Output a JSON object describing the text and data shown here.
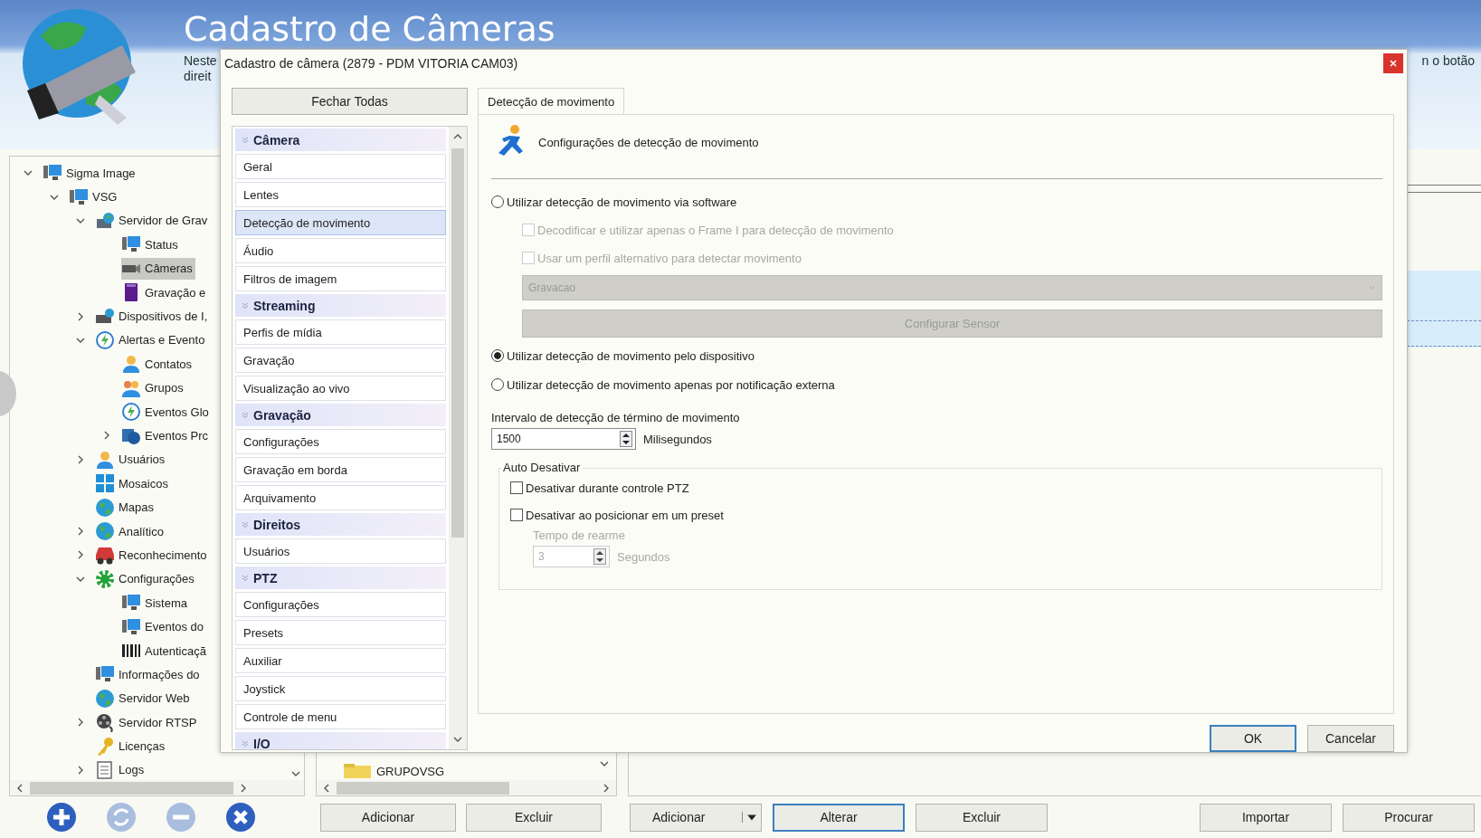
{
  "header": {
    "title": "Cadastro de Câmeras",
    "description_lines": [
      "Neste",
      "direit"
    ],
    "right_text": "n o botão"
  },
  "tree": {
    "items": [
      {
        "label": "Sigma Image",
        "expanded": true,
        "children": [
          {
            "label": "VSG",
            "expanded": true,
            "children": [
              {
                "label": "Servidor de Grav",
                "expanded": true,
                "children": [
                  {
                    "label": "Status",
                    "selected": false
                  },
                  {
                    "label": "Câmeras",
                    "selected": true
                  },
                  {
                    "label": "Gravação e",
                    "selected": false
                  }
                ],
                "selected": false
              },
              {
                "label": "Dispositivos de I,",
                "expanded": false,
                "selected": false
              },
              {
                "label": "Alertas e Evento",
                "expanded": true,
                "selected": false,
                "children": [
                  {
                    "label": "Contatos",
                    "selected": false
                  },
                  {
                    "label": "Grupos",
                    "selected": false
                  },
                  {
                    "label": "Eventos Glo",
                    "selected": false
                  },
                  {
                    "label": "Eventos Prc",
                    "expanded": false,
                    "selected": false
                  }
                ]
              },
              {
                "label": "Usuários",
                "expanded": false,
                "selected": false
              },
              {
                "label": "Mosaicos",
                "selected": false
              },
              {
                "label": "Mapas",
                "selected": false
              },
              {
                "label": "Analítico",
                "expanded": false,
                "selected": false
              },
              {
                "label": "Reconhecimento",
                "expanded": false,
                "selected": false
              },
              {
                "label": "Configurações",
                "expanded": true,
                "selected": false,
                "children": [
                  {
                    "label": "Sistema",
                    "selected": false
                  },
                  {
                    "label": "Eventos do",
                    "selected": false
                  },
                  {
                    "label": "Autenticaçã",
                    "selected": false
                  }
                ]
              },
              {
                "label": "Informações do",
                "selected": false
              },
              {
                "label": "Servidor Web",
                "selected": false
              },
              {
                "label": "Servidor RTSP",
                "expanded": false,
                "selected": false
              },
              {
                "label": "Licenças",
                "selected": false
              },
              {
                "label": "Logs",
                "expanded": false,
                "selected": false
              }
            ],
            "selected": false
          }
        ],
        "selected": false
      }
    ]
  },
  "group_tree": {
    "items": [
      {
        "label": "GRUPOVSG"
      }
    ]
  },
  "toolbar_icons": [
    {
      "disabled": false
    },
    {
      "disabled": true
    },
    {
      "disabled": true
    },
    {
      "disabled": false
    }
  ],
  "group_buttons": [
    {
      "label": "Adicionar",
      "focused": false
    },
    {
      "label": "Excluir",
      "focused": false
    }
  ],
  "member_buttons": [
    {
      "label": "Adicionar",
      "focused": false,
      "kind": "split"
    },
    {
      "label": "Alterar",
      "focused": true,
      "kind": "plain"
    },
    {
      "label": "Excluir",
      "focused": false,
      "kind": "plain"
    }
  ],
  "file_buttons": [
    {
      "label": "Importar",
      "focused": false
    },
    {
      "label": "Procurar",
      "focused": false
    }
  ],
  "dialog": {
    "title": "Cadastro de câmera (2879 - PDM VITORIA CAM03)",
    "close_all": "Fechar Todas",
    "sections": [
      {
        "title": "Câmera",
        "items": [
          {
            "label": "Geral",
            "selected": false
          },
          {
            "label": "Lentes",
            "selected": false
          },
          {
            "label": "Detecção de movimento",
            "selected": true
          },
          {
            "label": "Áudio",
            "selected": false
          },
          {
            "label": "Filtros de imagem",
            "selected": false
          }
        ]
      },
      {
        "title": "Streaming",
        "items": [
          {
            "label": "Perfis de mídia",
            "selected": false
          },
          {
            "label": "Gravação",
            "selected": false
          },
          {
            "label": "Visualização ao vivo",
            "selected": false
          }
        ]
      },
      {
        "title": "Gravação",
        "items": [
          {
            "label": "Configurações",
            "selected": false
          },
          {
            "label": "Gravação em borda",
            "selected": false
          },
          {
            "label": "Arquivamento",
            "selected": false
          }
        ]
      },
      {
        "title": "Direitos",
        "items": [
          {
            "label": "Usuários",
            "selected": false
          }
        ]
      },
      {
        "title": "PTZ",
        "items": [
          {
            "label": "Configurações",
            "selected": false
          },
          {
            "label": "Presets",
            "selected": false
          },
          {
            "label": "Auxiliar",
            "selected": false
          },
          {
            "label": "Joystick",
            "selected": false
          },
          {
            "label": "Controle de menu",
            "selected": false
          }
        ]
      },
      {
        "title": "I/O"
      }
    ],
    "tabs": [
      {
        "label": "Detecção de movimento",
        "selected": true
      }
    ],
    "heading": "Configurações de detecção de movimento",
    "software_option": {
      "label": "Utilizar detecção de movimento via software",
      "selected": false
    },
    "software_settings": [
      {
        "label": "Decodificar e utilizar apenas o Frame I para detecção de movimento",
        "checked": false,
        "disabled": true
      },
      {
        "label": "Usar um perfil alternativo para detectar movimento",
        "checked": false,
        "disabled": true
      }
    ],
    "profile_select": {
      "value": "Gravacao",
      "disabled": true
    },
    "sensor_button": {
      "label": "Configurar Sensor",
      "disabled": true
    },
    "other_options": [
      {
        "label": "Utilizar detecção de movimento pelo dispositivo",
        "selected": true
      },
      {
        "label": "Utilizar detecção de movimento apenas por notificação externa",
        "selected": false
      }
    ],
    "interval": {
      "label": "Intervalo de detecção de término de movimento",
      "value": "1500",
      "unit": "Milisegundos"
    },
    "auto_disable": {
      "title": "Auto Desativar",
      "options": [
        {
          "label": "Desativar durante controle PTZ",
          "checked": false
        },
        {
          "label": "Desativar ao posicionar em um preset",
          "checked": false
        }
      ],
      "rearm": {
        "label": "Tempo de rearme",
        "value": "3",
        "unit": "Segundos",
        "disabled": true
      }
    },
    "buttons": [
      {
        "label": "OK",
        "focused": true
      },
      {
        "label": "Cancelar",
        "focused": false
      }
    ]
  }
}
